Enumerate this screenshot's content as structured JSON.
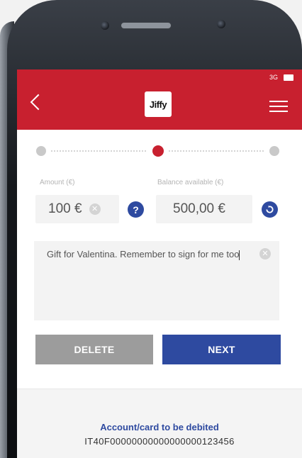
{
  "status": {
    "signal": "3G"
  },
  "header": {
    "logo_text": "Jiffy"
  },
  "form": {
    "amount_label": "Amount (€)",
    "amount_value": "100 €",
    "balance_label": "Balance available (€)",
    "balance_value": "500,00 €",
    "message_text": "Gift for Valentina. Remember to sign for me too"
  },
  "buttons": {
    "delete_label": "DELETE",
    "next_label": "NEXT"
  },
  "footer": {
    "debit_label": "Account/card to be debited",
    "iban": "IT40F00000000000000000123456"
  },
  "colors": {
    "brand_red": "#c8202f",
    "accent_blue": "#2e4aa0",
    "button_gray": "#9c9c9c"
  }
}
